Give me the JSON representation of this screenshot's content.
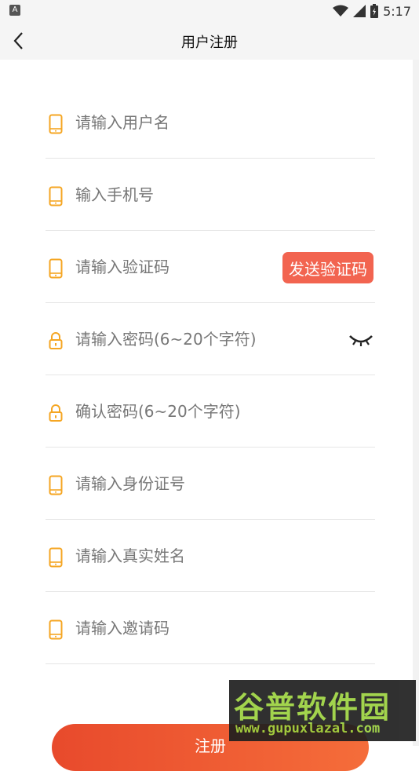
{
  "status_bar": {
    "notification_icon": "A",
    "time": "5:17",
    "icons": [
      "wifi-icon",
      "signal-icon",
      "battery-icon"
    ]
  },
  "header": {
    "title": "用户注册",
    "back_icon": "chevron-left-icon"
  },
  "form": {
    "username_placeholder": "请输入用户名",
    "phone_placeholder": "输入手机号",
    "code_placeholder": "请输入验证码",
    "send_code_label": "发送验证码",
    "password_placeholder": "请输入密码(6~20个字符)",
    "confirm_placeholder": "确认密码(6~20个字符)",
    "idcard_placeholder": "请输入身份证号",
    "realname_placeholder": "请输入真实姓名",
    "invite_placeholder": "请输入邀请码"
  },
  "submit_label": "注册",
  "watermark": {
    "brand": "谷普软件园",
    "url": "www.gupuxlazal.com"
  },
  "colors": {
    "accent_icon": "#f5a623",
    "send_button": "#f26450",
    "submit_start": "#e84a2c",
    "submit_end": "#f56d3a"
  }
}
